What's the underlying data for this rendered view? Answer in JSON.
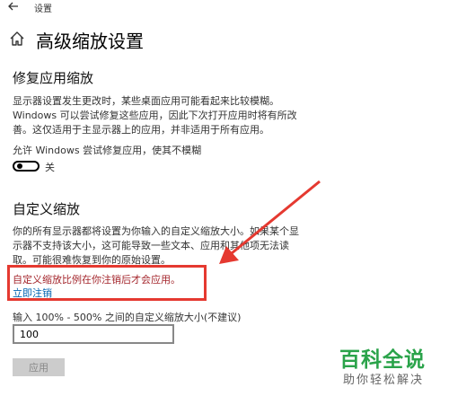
{
  "window": {
    "title": "设置",
    "back_icon": "arrow-left-icon"
  },
  "page": {
    "title": "高级缩放设置",
    "home_icon": "home-icon"
  },
  "fix_section": {
    "heading": "修复应用缩放",
    "description_lines": [
      "显示器设置发生更改时，某些桌面应用可能看起来比较模糊。",
      "Windows 可以尝试修复这些应用，因此下次打开应用时将有所改",
      "善。这仅适用于主显示器上的应用，并非适用于所有应用。"
    ],
    "toggle_label": "允许 Windows 尝试修复应用，使其不模糊",
    "toggle_state_text": "关",
    "toggle_on": false
  },
  "custom_section": {
    "heading": "自定义缩放",
    "description_lines": [
      "你的所有显示器都将设置为你输入的自定义缩放大小。如果某个显",
      "示器不支持该大小，这可能导致一些文本、应用和其他项无法读",
      "取。可能很难恢复到你的原始设置。"
    ],
    "notice_text": "自定义缩放比例在你注销后才会应用。",
    "signout_link": "立即注销",
    "input_label": "输入 100% - 500% 之间的自定义缩放大小(不建议)",
    "input_value": "100",
    "apply_label": "应用"
  },
  "watermark": {
    "title": "百科全说",
    "subtitle": "助你轻松解决"
  },
  "colors": {
    "annotation_red": "#e53930",
    "link_blue": "#0063b1",
    "notice_red": "#a4262c",
    "watermark_green": "#2aa34a"
  }
}
